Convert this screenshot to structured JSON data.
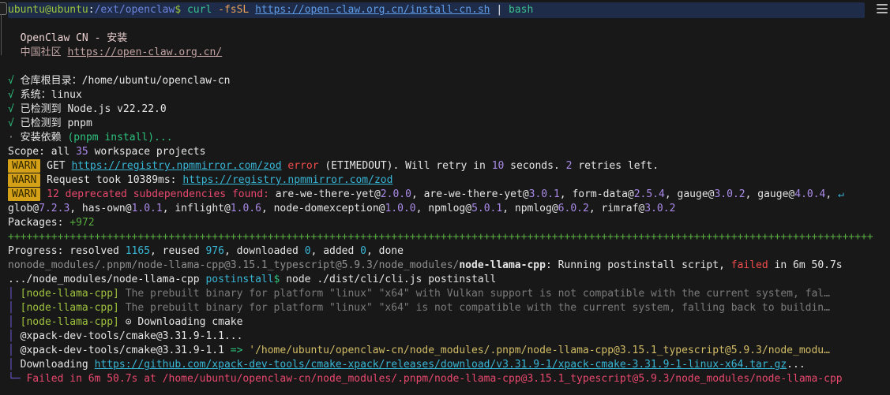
{
  "colors": {
    "white": "#e6e6e6",
    "gray": "#8f8f8f",
    "dimGray": "#7b7b7b",
    "promptGreen": "#9bc53d",
    "green": "#2ec27e",
    "lime": "#57ab40",
    "teal": "#3cc08e",
    "orange": "#e9a158",
    "red": "#f14c4c",
    "crimson": "#e8486e",
    "purple": "#a98ae8",
    "cyan": "#38b6d6",
    "linkBlue": "#5f9ce8",
    "pathBlue": "#6d84dd",
    "headerPink": "#ecd2d2",
    "dimPink": "#c2a3a3",
    "yellow": "#d2bd66",
    "tagGreen": "#9fc23f",
    "barPurple": "#6f5bd1",
    "badgeBg": "#d4a017",
    "badgeText": "#2e2500",
    "cmdbarBg": "#1e2c49",
    "terminalBg": "#181818"
  },
  "icons": {
    "menu": "hamburger-menu",
    "wrap": "↵",
    "spinner": "⊙",
    "check": "√"
  },
  "terminal": {
    "lines": [
      {
        "cls": "cmdbar",
        "name": "prompt-line",
        "segs": [
          {
            "t": "ubuntu@ubuntu",
            "c": "promptGreen",
            "n": "prompt-user-host"
          },
          {
            "t": ":",
            "c": "white"
          },
          {
            "t": "/ext/openclaw",
            "c": "pathBlue",
            "n": "prompt-cwd"
          },
          {
            "t": "$ ",
            "c": "promptGreen",
            "n": "prompt-symbol"
          },
          {
            "t": "curl ",
            "c": "teal",
            "n": "command-name"
          },
          {
            "t": "-fsSL ",
            "c": "orange",
            "n": "command-flags"
          },
          {
            "t": "https://open-claw.org.cn/install-cn.sh",
            "c": "linkBlue",
            "u": true,
            "n": "link",
            "i": true
          },
          {
            "t": " | ",
            "c": "white"
          },
          {
            "t": "bash",
            "c": "teal",
            "n": "command-name"
          }
        ]
      },
      {
        "segs": []
      },
      {
        "name": "installer-title-line",
        "segs": [
          {
            "t": "  OpenClaw CN - 安装",
            "c": "headerPink",
            "n": "installer-title"
          }
        ]
      },
      {
        "name": "community-line",
        "segs": [
          {
            "t": "  中国社区 ",
            "c": "dimPink",
            "n": "community-label"
          },
          {
            "t": "https://open-claw.org.cn/",
            "c": "dimPink",
            "u": true,
            "n": "link",
            "i": true
          }
        ]
      },
      {
        "segs": []
      },
      {
        "segs": [
          {
            "t": "√",
            "c": "green",
            "n": "check-icon"
          },
          {
            "t": " 仓库根目录：/home/ubuntu/openclaw-cn",
            "c": "white"
          }
        ]
      },
      {
        "segs": [
          {
            "t": "√",
            "c": "green",
            "n": "check-icon"
          },
          {
            "t": " 系统：linux",
            "c": "white"
          }
        ]
      },
      {
        "segs": [
          {
            "t": "√",
            "c": "green",
            "n": "check-icon"
          },
          {
            "t": " 已检测到 Node.js v22.22.0",
            "c": "white"
          }
        ]
      },
      {
        "segs": [
          {
            "t": "√",
            "c": "green",
            "n": "check-icon"
          },
          {
            "t": " 已检测到 pnpm",
            "c": "white"
          }
        ]
      },
      {
        "segs": [
          {
            "t": "·",
            "c": "gray",
            "n": "bullet-icon"
          },
          {
            "t": " 安装依赖 ",
            "c": "white"
          },
          {
            "t": "(pnpm install)...",
            "c": "green"
          }
        ]
      },
      {
        "segs": [
          {
            "t": "Scope: all ",
            "c": "white"
          },
          {
            "t": "35",
            "c": "purple"
          },
          {
            "t": " workspace projects",
            "c": "white"
          }
        ]
      },
      {
        "segs": [
          {
            "t": "WARN",
            "badge": true
          },
          {
            "t": " GET ",
            "c": "white"
          },
          {
            "t": "https://registry.npmmirror.com/zod",
            "c": "cyan",
            "u": true,
            "n": "link",
            "i": true
          },
          {
            "t": " error",
            "c": "red"
          },
          {
            "t": " (ETIMEDOUT). Will retry in ",
            "c": "white"
          },
          {
            "t": "10",
            "c": "purple"
          },
          {
            "t": " seconds. ",
            "c": "white"
          },
          {
            "t": "2",
            "c": "purple"
          },
          {
            "t": " retries left.",
            "c": "white"
          }
        ]
      },
      {
        "segs": [
          {
            "t": "WARN",
            "badge": true
          },
          {
            "t": " Request took 10389ms: ",
            "c": "white"
          },
          {
            "t": "https://registry.npmmirror.com/zod",
            "c": "cyan",
            "u": true,
            "n": "link",
            "i": true
          }
        ]
      },
      {
        "segs": [
          {
            "t": "WARN",
            "badge": true
          },
          {
            "t": " ",
            "c": "white"
          },
          {
            "t": "12 deprecated subdependencies found:",
            "c": "crimson"
          },
          {
            "t": " are-we-there-yet@",
            "c": "white"
          },
          {
            "t": "2.0.0",
            "c": "purple"
          },
          {
            "t": ", are-we-there-yet@",
            "c": "white"
          },
          {
            "t": "3.0.1",
            "c": "purple"
          },
          {
            "t": ", form-data@",
            "c": "white"
          },
          {
            "t": "2.5.4",
            "c": "purple"
          },
          {
            "t": ", gauge@",
            "c": "white"
          },
          {
            "t": "3.0.2",
            "c": "purple"
          },
          {
            "t": ", gauge@",
            "c": "white"
          },
          {
            "t": "4.0.4",
            "c": "purple"
          },
          {
            "t": ", ",
            "c": "white"
          },
          {
            "t": "↵",
            "c": "cyan",
            "n": "wrap-icon"
          }
        ]
      },
      {
        "segs": [
          {
            "t": "glob@",
            "c": "white"
          },
          {
            "t": "7.2.3",
            "c": "purple"
          },
          {
            "t": ", has-own@",
            "c": "white"
          },
          {
            "t": "1.0.1",
            "c": "purple"
          },
          {
            "t": ", inflight@",
            "c": "white"
          },
          {
            "t": "1.0.6",
            "c": "purple"
          },
          {
            "t": ", node-domexception@",
            "c": "white"
          },
          {
            "t": "1.0.0",
            "c": "purple"
          },
          {
            "t": ", npmlog@",
            "c": "white"
          },
          {
            "t": "5.0.1",
            "c": "purple"
          },
          {
            "t": ", npmlog@",
            "c": "white"
          },
          {
            "t": "6.0.2",
            "c": "purple"
          },
          {
            "t": ", rimraf@",
            "c": "white"
          },
          {
            "t": "3.0.2",
            "c": "purple"
          }
        ]
      },
      {
        "segs": [
          {
            "t": "Packages: ",
            "c": "white"
          },
          {
            "t": "+972",
            "c": "lime"
          }
        ]
      },
      {
        "name": "progress-bar-line",
        "segs": [
          {
            "t": "++++++++++++++++++++++++++++++++++++++++++++++++++++++++++++++++++++++++++++++++++++++++++++++++++++++++++++++++++++++++++++++++++++++++++++",
            "c": "lime",
            "n": "progress-plus-bar"
          }
        ]
      },
      {
        "segs": [
          {
            "t": "Progress: resolved ",
            "c": "white"
          },
          {
            "t": "1165",
            "c": "cyan"
          },
          {
            "t": ", reused ",
            "c": "white"
          },
          {
            "t": "976",
            "c": "cyan"
          },
          {
            "t": ", downloaded ",
            "c": "white"
          },
          {
            "t": "0",
            "c": "cyan"
          },
          {
            "t": ", added ",
            "c": "white"
          },
          {
            "t": "0",
            "c": "cyan"
          },
          {
            "t": ", done",
            "c": "white"
          }
        ]
      },
      {
        "segs": [
          {
            "t": "nonode_modules/.pnpm/node-llama-cpp@3.15.1_typescript@5.9.3/node_modules/",
            "c": "gray"
          },
          {
            "t": "node-llama-cpp",
            "c": "white",
            "b": true
          },
          {
            "t": ": Running postinstall script, ",
            "c": "white"
          },
          {
            "t": "failed",
            "c": "red"
          },
          {
            "t": " in 6m 50.7s",
            "c": "white"
          }
        ]
      },
      {
        "segs": [
          {
            "t": ".../node_modules/node-llama-cpp ",
            "c": "white"
          },
          {
            "t": "postinstall",
            "c": "cyan"
          },
          {
            "t": "$",
            "c": "green"
          },
          {
            "t": " node ./dist/cli/cli.js postinstall",
            "c": "white"
          }
        ]
      },
      {
        "segs": [
          {
            "t": "│",
            "c": "barPurple",
            "n": "pipe-bar-icon"
          },
          {
            "t": " ",
            "c": "white"
          },
          {
            "t": "[node-llama-cpp]",
            "c": "tagGreen",
            "n": "package-tag"
          },
          {
            "t": " The prebuilt binary for platform \"linux\" \"x64\" with Vulkan support is not compatible with the current system, fal…",
            "c": "dimGray"
          }
        ]
      },
      {
        "segs": [
          {
            "t": "│",
            "c": "barPurple",
            "n": "pipe-bar-icon"
          },
          {
            "t": " ",
            "c": "white"
          },
          {
            "t": "[node-llama-cpp]",
            "c": "tagGreen",
            "n": "package-tag"
          },
          {
            "t": " The prebuilt binary for platform \"linux\" \"x64\" is not compatible with the current system, falling back to buildin…",
            "c": "dimGray"
          }
        ]
      },
      {
        "segs": [
          {
            "t": "│",
            "c": "barPurple",
            "n": "pipe-bar-icon"
          },
          {
            "t": " ",
            "c": "white"
          },
          {
            "t": "[node-llama-cpp]",
            "c": "tagGreen",
            "n": "package-tag"
          },
          {
            "t": " ",
            "c": "white"
          },
          {
            "t": "⊙",
            "c": "white",
            "n": "spinner-icon"
          },
          {
            "t": " Downloading cmake",
            "c": "white"
          }
        ]
      },
      {
        "segs": [
          {
            "t": "│",
            "c": "barPurple",
            "n": "pipe-bar-icon"
          },
          {
            "t": " @xpack-dev-tools/cmake@3.31.9-1.1...",
            "c": "white"
          }
        ]
      },
      {
        "segs": [
          {
            "t": "│",
            "c": "barPurple",
            "n": "pipe-bar-icon"
          },
          {
            "t": " @xpack-dev-tools/cmake@3.31.9-1.1 ",
            "c": "white"
          },
          {
            "t": "=>",
            "c": "green"
          },
          {
            "t": " ",
            "c": "white"
          },
          {
            "t": "'/home/ubuntu/openclaw-cn/node_modules/.pnpm/node-llama-cpp@3.15.1_typescript@5.9.3/node_modu…",
            "c": "yellow"
          }
        ]
      },
      {
        "segs": [
          {
            "t": "│",
            "c": "barPurple",
            "n": "pipe-bar-icon"
          },
          {
            "t": " Downloading ",
            "c": "white"
          },
          {
            "t": "https://github.com/xpack-dev-tools/cmake-xpack/releases/download/v3.31.9-1/xpack-cmake-3.31.9-1-linux-x64.tar.gz",
            "c": "cyan",
            "u": true,
            "n": "link",
            "i": true
          },
          {
            "t": "...",
            "c": "white"
          }
        ]
      },
      {
        "name": "failed-line",
        "segs": [
          {
            "t": "└─",
            "c": "barPurple",
            "n": "tree-corner-icon"
          },
          {
            "t": " Failed in 6m 50.7s at /home/ubuntu/openclaw-cn/node_modules/.pnpm/node-llama-cpp@3.15.1_typescript@5.9.3/node_modules/node-llama-cpp",
            "c": "crimson",
            "n": "failed-message"
          }
        ]
      }
    ]
  }
}
